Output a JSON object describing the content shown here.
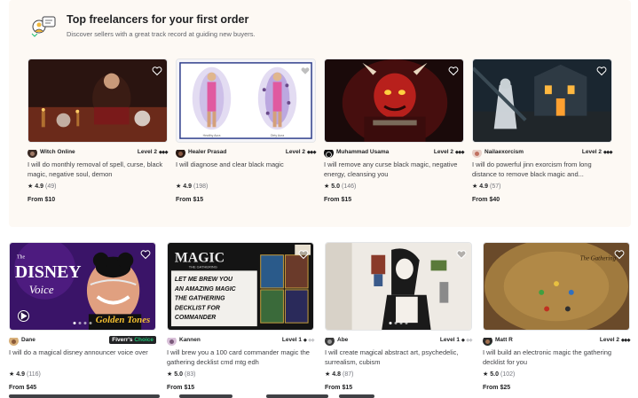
{
  "section": {
    "title": "Top freelancers for your first order",
    "subtitle": "Discover sellers with a great track record at guiding new buyers."
  },
  "row1": [
    {
      "seller": "Witch Online",
      "level": "Level 2",
      "desc": "I will do monthly removal of spell, curse, black magic, negative soul, demon",
      "score": "4.9",
      "count": "(49)",
      "price": "From $10"
    },
    {
      "seller": "Healer Prasad",
      "level": "Level 2",
      "desc": "I will diagnose and clear black magic",
      "score": "4.9",
      "count": "(198)",
      "price": "From $15",
      "caption_left": "Healthy Aura",
      "caption_right": "Dirty Aura"
    },
    {
      "seller": "Muhammad Usama",
      "level": "Level 2",
      "desc": "I will remove any curse black magic, negative energy, cleansing you",
      "score": "5.0",
      "count": "(146)",
      "price": "From $15"
    },
    {
      "seller": "Nailaexorcism",
      "level": "Level 2",
      "desc": "I will do powerful jinn exorcism from long distance to remove black magic and...",
      "score": "4.9",
      "count": "(57)",
      "price": "From $40"
    }
  ],
  "row2": [
    {
      "seller": "Dane",
      "badge_a": "Fiverr's",
      "badge_b": "Choice",
      "desc": "I will do a magical disney announcer voice over",
      "score": "4.9",
      "count": "(116)",
      "price": "From $45",
      "thumb_title_a": "The",
      "thumb_title_b": "DISNEY",
      "thumb_title_c": "Voice",
      "thumb_tag": "Golden Tones"
    },
    {
      "seller": "Kannen",
      "level": "Level 1",
      "desc": "I will brew you a 100 card commander magic the gathering decklist cmd mtg edh",
      "score": "5.0",
      "count": "(83)",
      "price": "From $15",
      "thumb_brand": "MAGIC",
      "thumb_brand_sub": "THE GATHERING",
      "thumb_lines": [
        "LET ME BREW YOU",
        "AN AMAZING MAGIC",
        "THE GATHERING",
        "DECKLIST FOR",
        "COMMANDER"
      ]
    },
    {
      "seller": "Abe",
      "level": "Level 1",
      "desc": "I will create magical abstract art, psychedelic, surrealism, cubism",
      "score": "4.8",
      "count": "(87)",
      "price": "From $15"
    },
    {
      "seller": "Matt R",
      "level": "Level 2",
      "desc": "I will build an electronic magic the gathering decklist for you",
      "score": "5.0",
      "count": "(102)",
      "price": "From $25",
      "thumb_text": "The Gathering"
    }
  ],
  "icons": {
    "heart": "heart-icon",
    "star": "star-icon",
    "play": "play-icon",
    "diamond": "level-diamond-icon"
  },
  "colors": {
    "panel_bg": "#fdf9f4",
    "badge_bg": "#222325",
    "choice_green": "#1dbf73",
    "text": "#404145"
  }
}
